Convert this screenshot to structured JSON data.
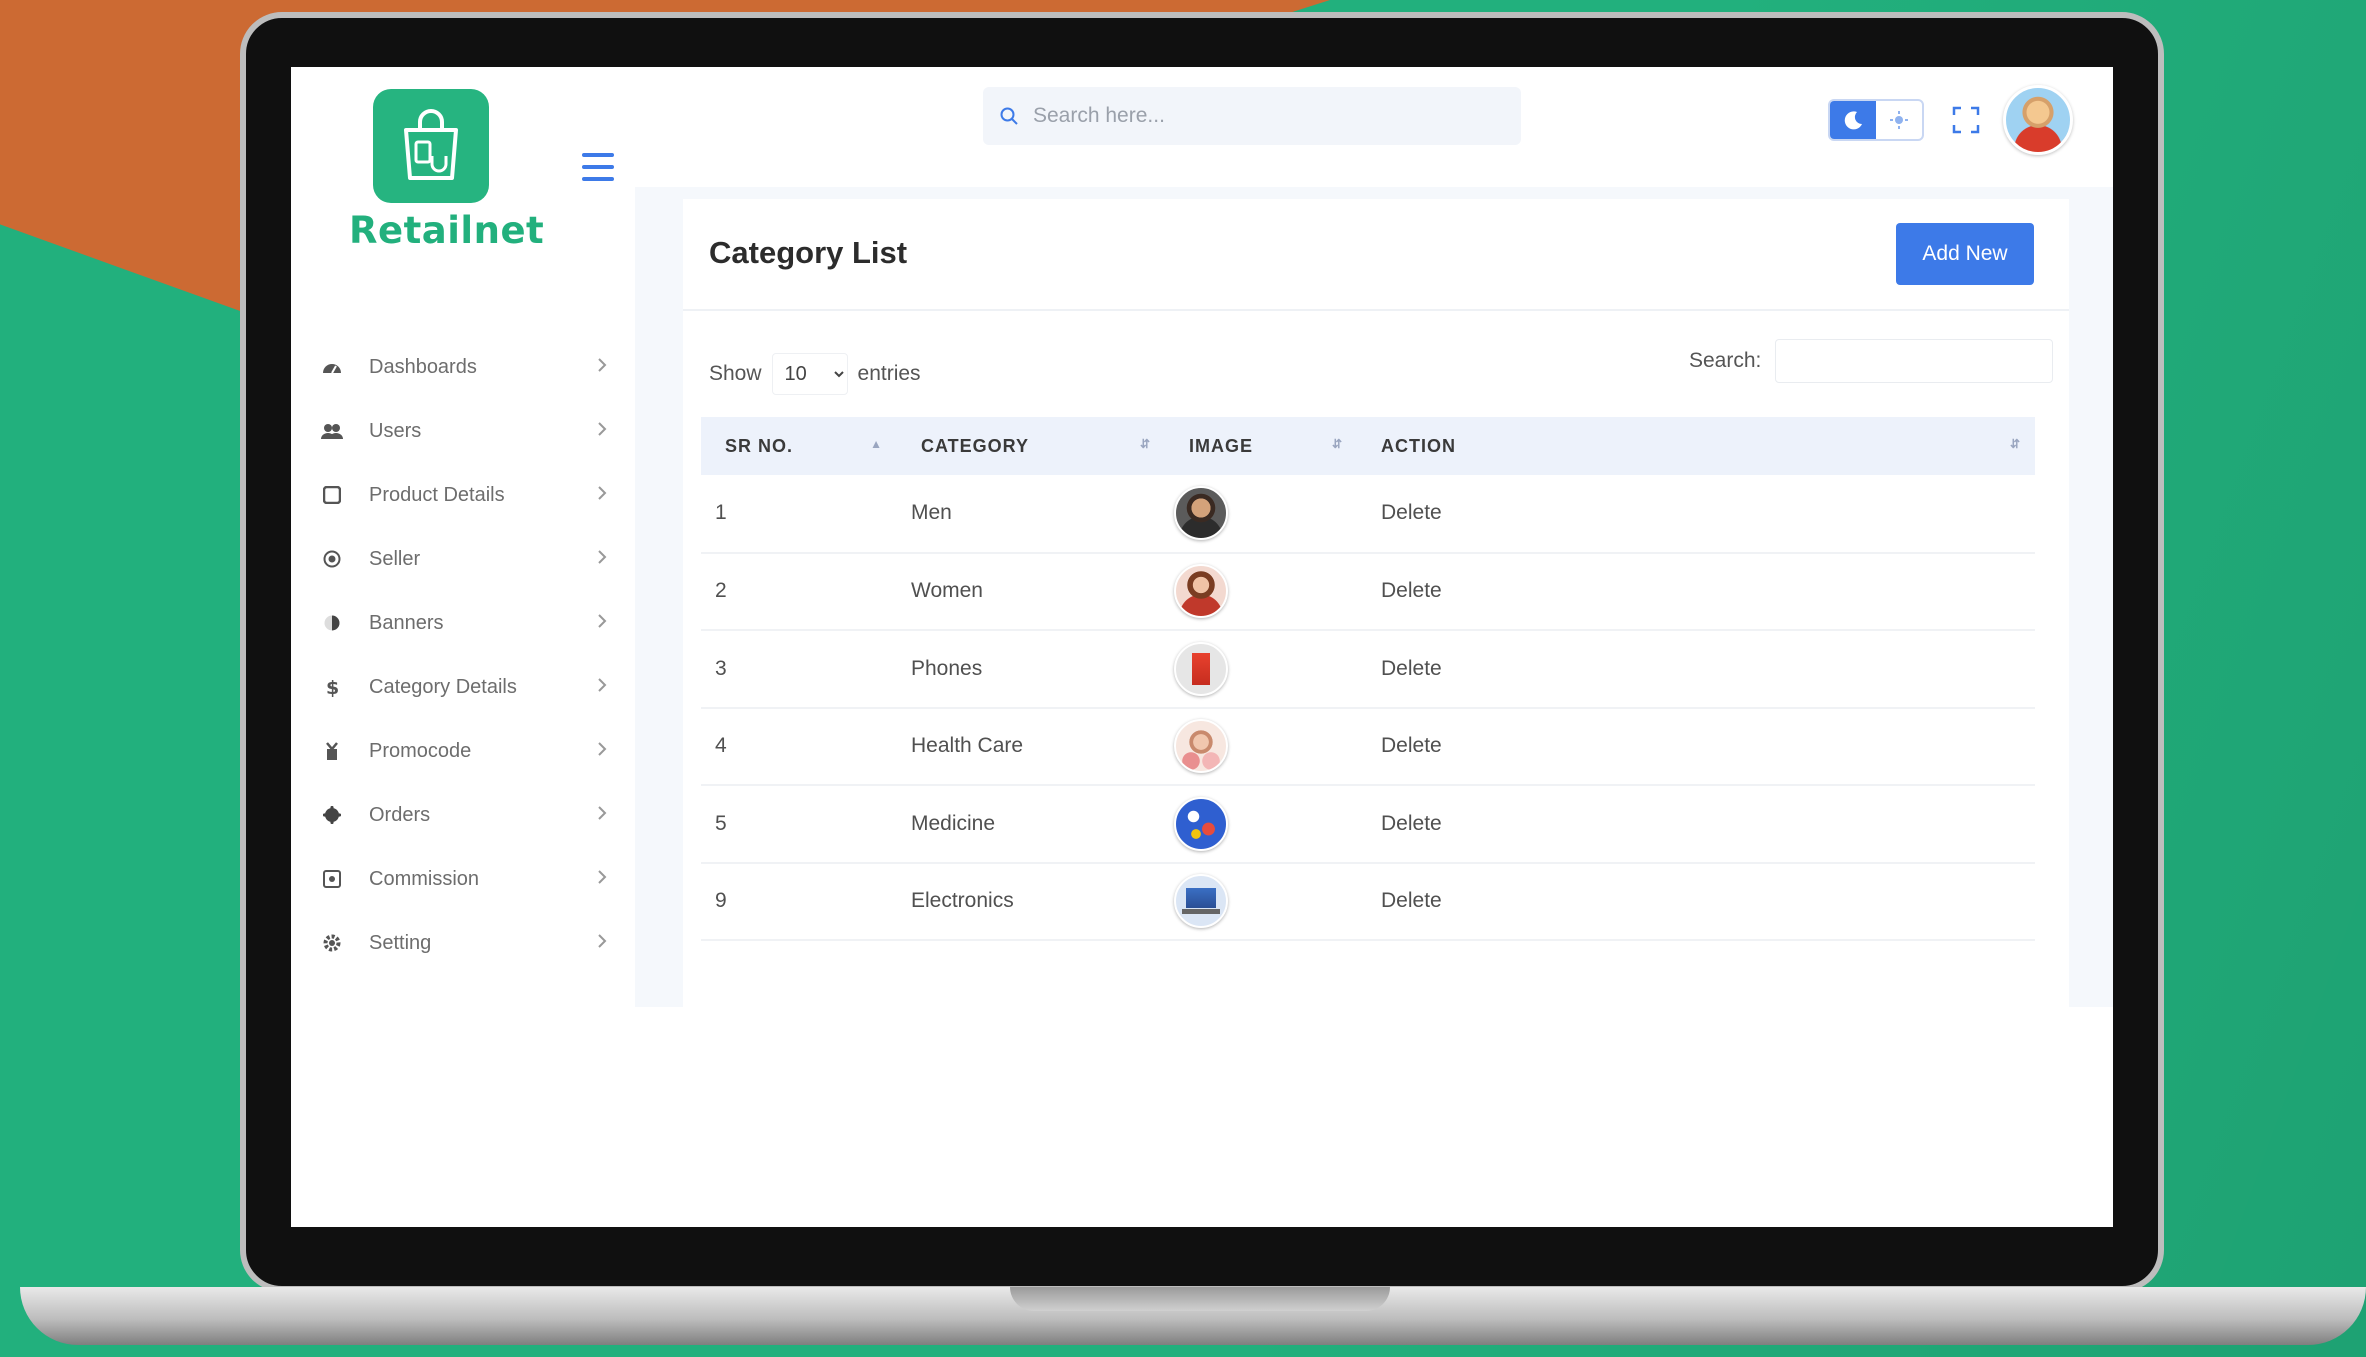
{
  "brand": {
    "name": "Retailnet"
  },
  "topbar": {
    "search_placeholder": "Search here..."
  },
  "sidebar": {
    "items": [
      {
        "label": "Dashboards",
        "icon": "dashboard-icon"
      },
      {
        "label": "Users",
        "icon": "users-icon"
      },
      {
        "label": "Product Details",
        "icon": "box-icon"
      },
      {
        "label": "Seller",
        "icon": "seller-icon"
      },
      {
        "label": "Banners",
        "icon": "banner-icon"
      },
      {
        "label": "Category Details",
        "icon": "dollar-icon"
      },
      {
        "label": "Promocode",
        "icon": "gift-icon"
      },
      {
        "label": "Orders",
        "icon": "orders-icon"
      },
      {
        "label": "Commission",
        "icon": "commission-icon"
      },
      {
        "label": "Setting",
        "icon": "gear-icon"
      }
    ]
  },
  "page": {
    "title": "Category List",
    "add_button": "Add New",
    "show_label": "Show",
    "entries_value": "10",
    "entries_label": "entries",
    "search_label": "Search:"
  },
  "table": {
    "columns": [
      "SR NO.",
      "CATEGORY",
      "IMAGE",
      "ACTION"
    ],
    "rows": [
      {
        "sr": "1",
        "category": "Men",
        "image": "man-portrait",
        "action": "Delete"
      },
      {
        "sr": "2",
        "category": "Women",
        "image": "woman-portrait",
        "action": "Delete"
      },
      {
        "sr": "3",
        "category": "Phones",
        "image": "red-phone",
        "action": "Delete"
      },
      {
        "sr": "4",
        "category": "Health Care",
        "image": "health-care-products",
        "action": "Delete"
      },
      {
        "sr": "5",
        "category": "Medicine",
        "image": "medicine-pills",
        "action": "Delete"
      },
      {
        "sr": "9",
        "category": "Electronics",
        "image": "laptop",
        "action": "Delete"
      }
    ]
  },
  "colors": {
    "brand_green": "#22b07d",
    "accent_blue": "#3d7ae8"
  }
}
